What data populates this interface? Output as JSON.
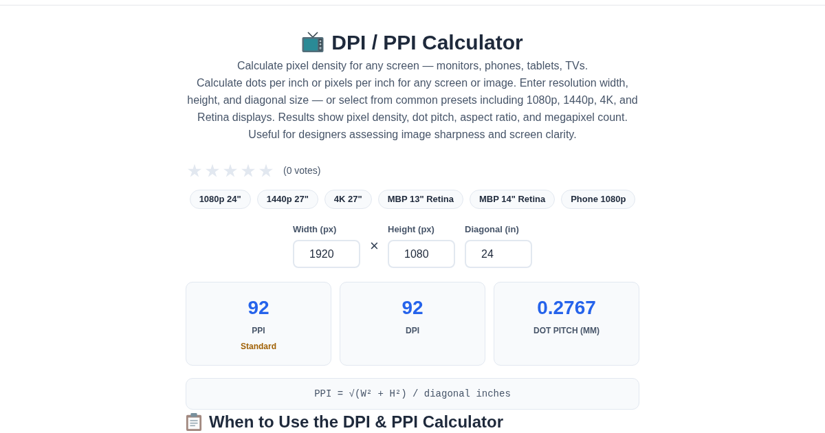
{
  "title": "DPI / PPI Calculator",
  "tagline": "Calculate pixel density for any screen — monitors, phones, tablets, TVs.",
  "description": "Calculate dots per inch or pixels per inch for any screen or image. Enter resolution width, height, and diagonal size — or select from common presets including 1080p, 1440p, 4K, and Retina displays. Results show pixel density, dot pitch, aspect ratio, and megapixel count. Useful for designers assessing image sharpness and screen clarity.",
  "rating": {
    "stars": 0,
    "votes": "(0 votes)"
  },
  "presets": [
    "1080p 24\"",
    "1440p 27\"",
    "4K 27\"",
    "MBP 13\" Retina",
    "MBP 14\" Retina",
    "Phone 1080p"
  ],
  "inputs": [
    {
      "label": "Width (px)",
      "value": "1920"
    },
    {
      "label": "Height (px)",
      "value": "1080"
    },
    {
      "label": "Diagonal (in)",
      "value": "24"
    }
  ],
  "separator": "×",
  "results": [
    {
      "value": "92",
      "label": "PPI",
      "rating": "Standard"
    },
    {
      "value": "92",
      "label": "DPI"
    },
    {
      "value": "0.2767",
      "label": "DOT PITCH (MM)"
    }
  ],
  "formula": "PPI = √(W² + H²) / diagonal inches",
  "section_heading": "When to Use the DPI & PPI Calculator"
}
